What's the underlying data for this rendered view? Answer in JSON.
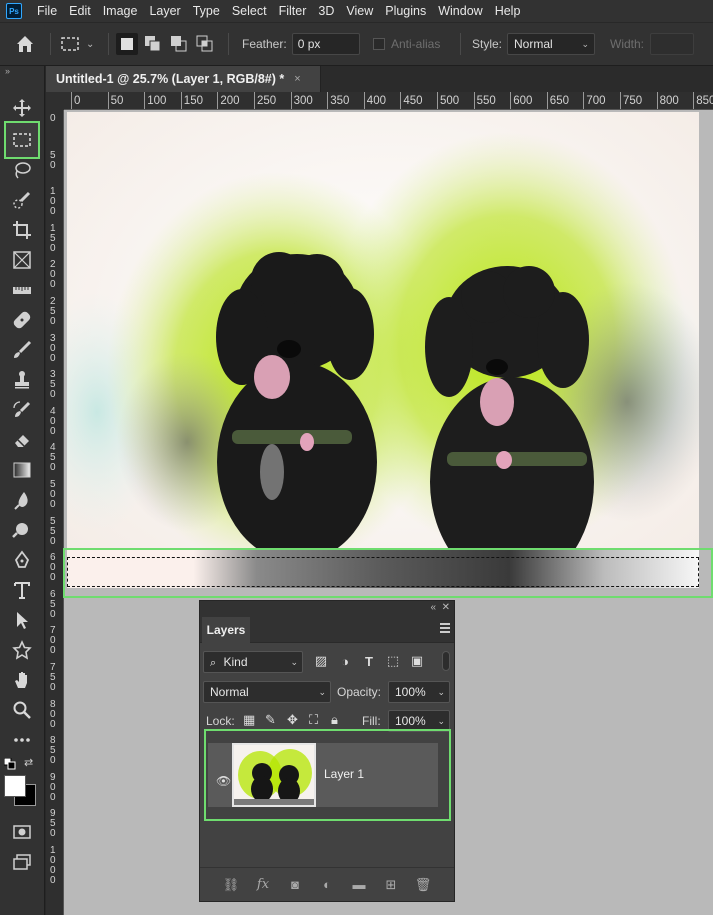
{
  "app": {
    "logo_text": "Ps"
  },
  "menu": [
    "File",
    "Edit",
    "Image",
    "Layer",
    "Type",
    "Select",
    "Filter",
    "3D",
    "View",
    "Plugins",
    "Window",
    "Help"
  ],
  "options": {
    "feather_label": "Feather:",
    "feather_value": "0 px",
    "antialias_label": "Anti-alias",
    "style_label": "Style:",
    "style_value": "Normal",
    "width_label": "Width:",
    "width_value": ""
  },
  "document": {
    "tab_title": "Untitled-1 @ 25.7% (Layer 1, RGB/8#) *",
    "close_glyph": "×"
  },
  "ruler": {
    "h_labels": [
      "0",
      "50",
      "100",
      "150",
      "200",
      "250",
      "300",
      "350",
      "400",
      "450",
      "500",
      "550",
      "600",
      "650",
      "700",
      "750",
      "800",
      "850"
    ],
    "v_labels": [
      "0",
      "5\n0",
      "1\n0\n0",
      "1\n5\n0",
      "2\n0\n0",
      "2\n5\n0",
      "3\n0\n0",
      "3\n5\n0",
      "4\n0\n0",
      "4\n5\n0",
      "5\n0\n0",
      "5\n5\n0",
      "6\n0\n0",
      "6\n5\n0",
      "7\n0\n0",
      "7\n5\n0",
      "8\n0\n0",
      "8\n5\n0",
      "9\n0\n0",
      "9\n5\n0",
      "1\n0\n0\n0"
    ]
  },
  "layers_panel": {
    "tab": "Layers",
    "kind_label": "Kind",
    "blend_mode": "Normal",
    "opacity_label": "Opacity:",
    "opacity_value": "100%",
    "lock_label": "Lock:",
    "fill_label": "Fill:",
    "fill_value": "100%",
    "layers": [
      {
        "name": "Layer 1",
        "visible": true
      }
    ]
  },
  "colors": {
    "highlight": "#6fdc6f",
    "foreground": "#ffffff",
    "background": "#000000",
    "lime": "#b4e600"
  }
}
